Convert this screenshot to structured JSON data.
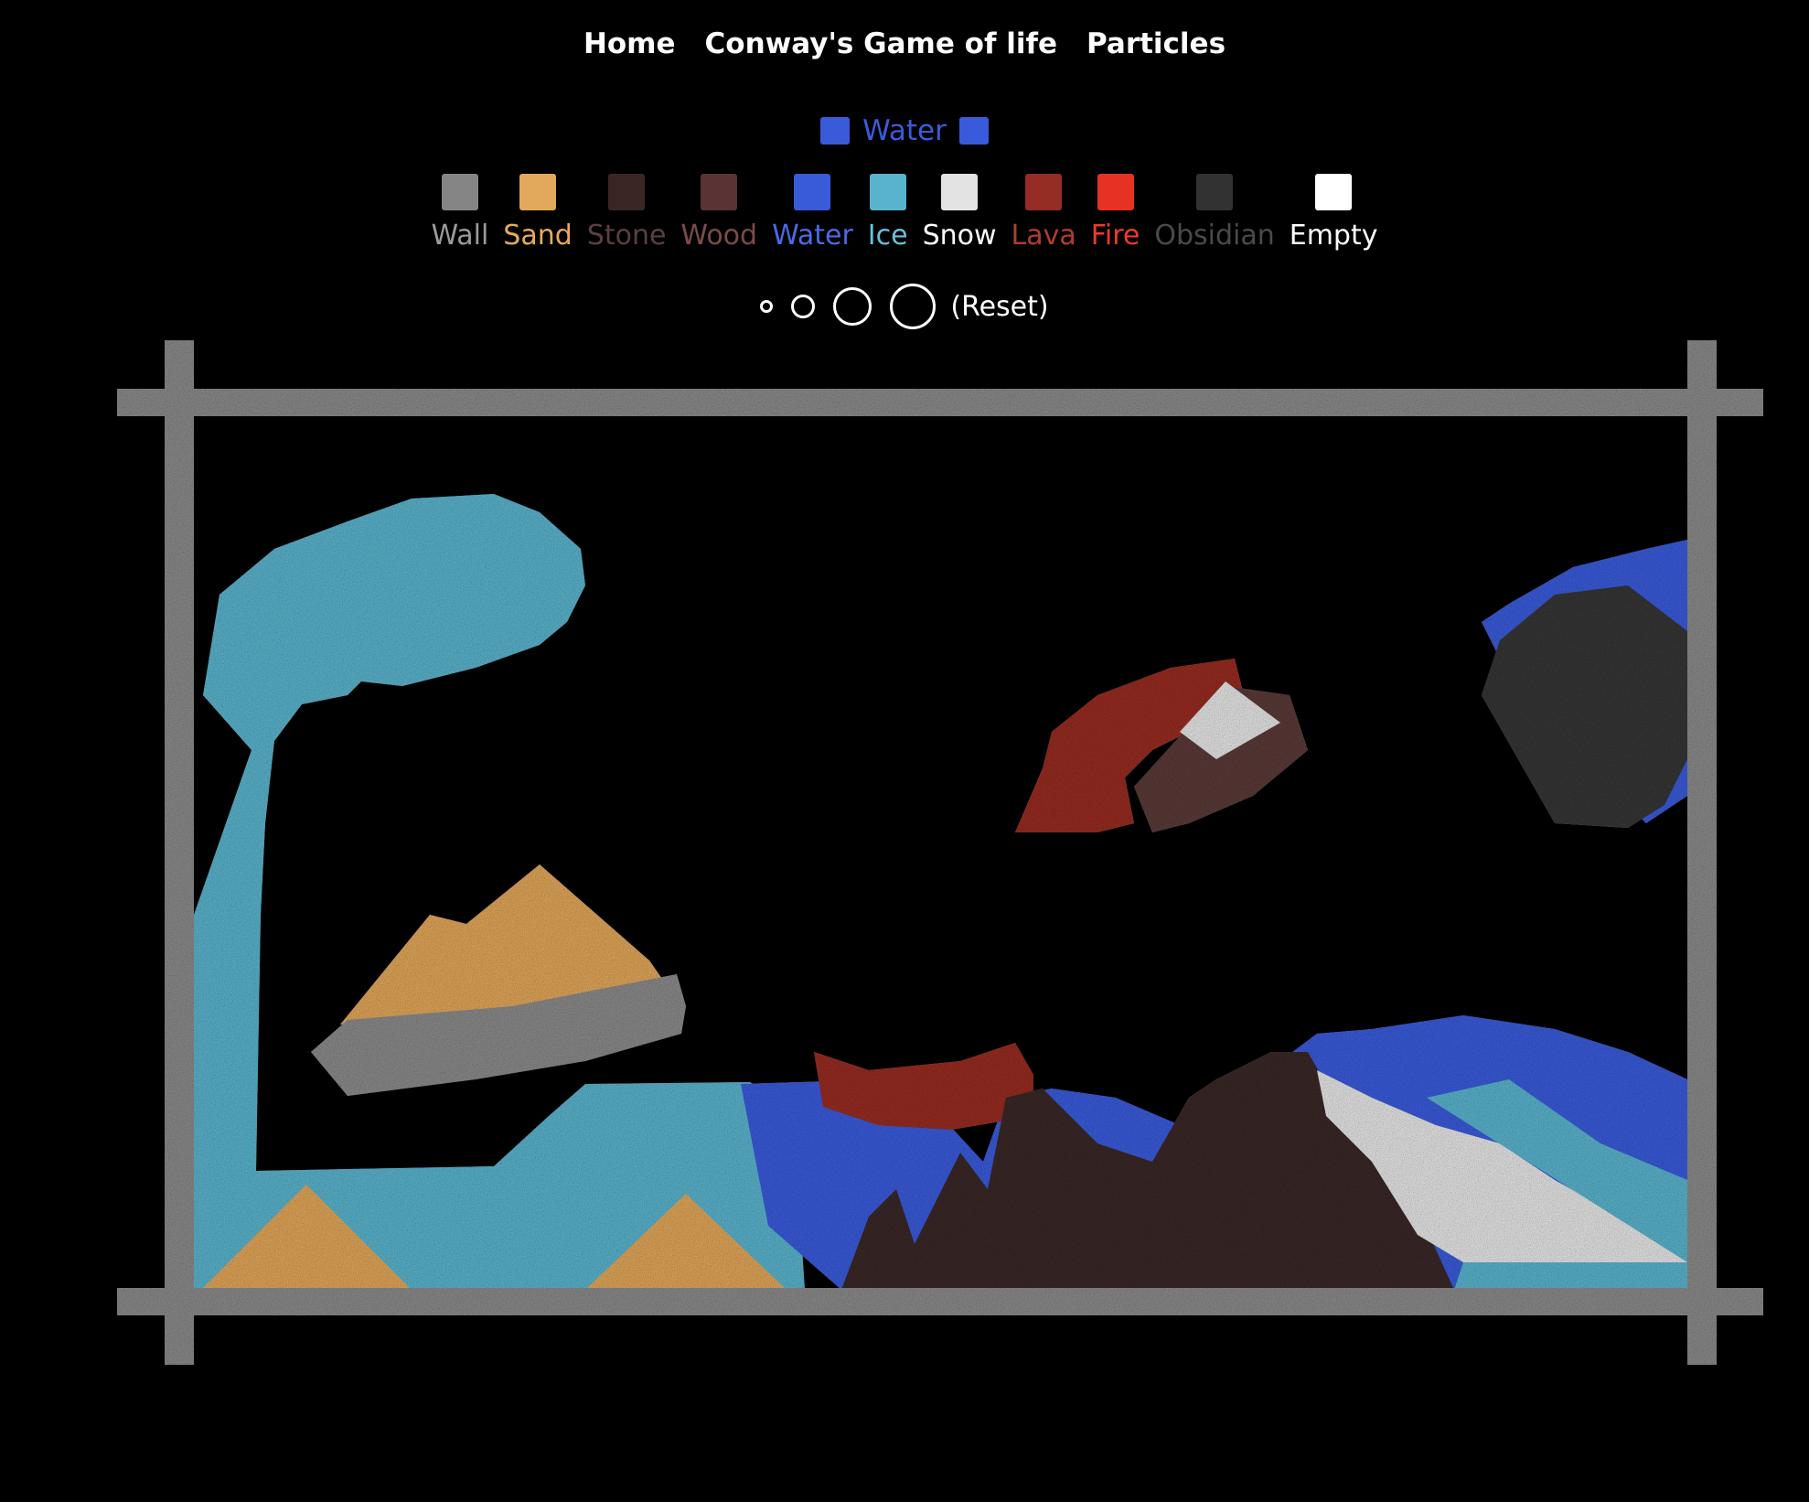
{
  "nav": [
    {
      "label": "Home"
    },
    {
      "label": "Conway's Game of life"
    },
    {
      "label": "Particles"
    }
  ],
  "selected": {
    "label": "Water",
    "color": "#3a5bd9"
  },
  "palette": [
    {
      "label": "Wall",
      "color": "#858585",
      "text_color": "#9a9a9a"
    },
    {
      "label": "Sand",
      "color": "#e2a85c",
      "text_color": "#e8aa5a"
    },
    {
      "label": "Stone",
      "color": "#3b2626",
      "text_color": "#5a4040"
    },
    {
      "label": "Wood",
      "color": "#5a3434",
      "text_color": "#7a4c48"
    },
    {
      "label": "Water",
      "color": "#3a5bd9",
      "text_color": "#4a6ae6"
    },
    {
      "label": "Ice",
      "color": "#5ab3cc",
      "text_color": "#66c1d8"
    },
    {
      "label": "Snow",
      "color": "#e3e3e3",
      "text_color": "#ffffff"
    },
    {
      "label": "Lava",
      "color": "#952d24",
      "text_color": "#b33a2e"
    },
    {
      "label": "Fire",
      "color": "#e63225",
      "text_color": "#ee3a2a"
    },
    {
      "label": "Obsidian",
      "color": "#323232",
      "text_color": "#4a4a4a"
    },
    {
      "label": "Empty",
      "color": "#ffffff",
      "text_color": "#ffffff"
    }
  ],
  "brush_sizes": [
    "tiny",
    "small",
    "medium",
    "large"
  ],
  "reset_label": "(Reset)",
  "sim_colors": {
    "wall": "#8a8a8a",
    "sand": "#e0a65a",
    "stone": "#3a2828",
    "wood": "#5a3a38",
    "water": "#3a5bd9",
    "ice": "#5ab3cc",
    "snow": "#e5e5e5",
    "lava": "#972c22",
    "obsidian": "#363636"
  }
}
